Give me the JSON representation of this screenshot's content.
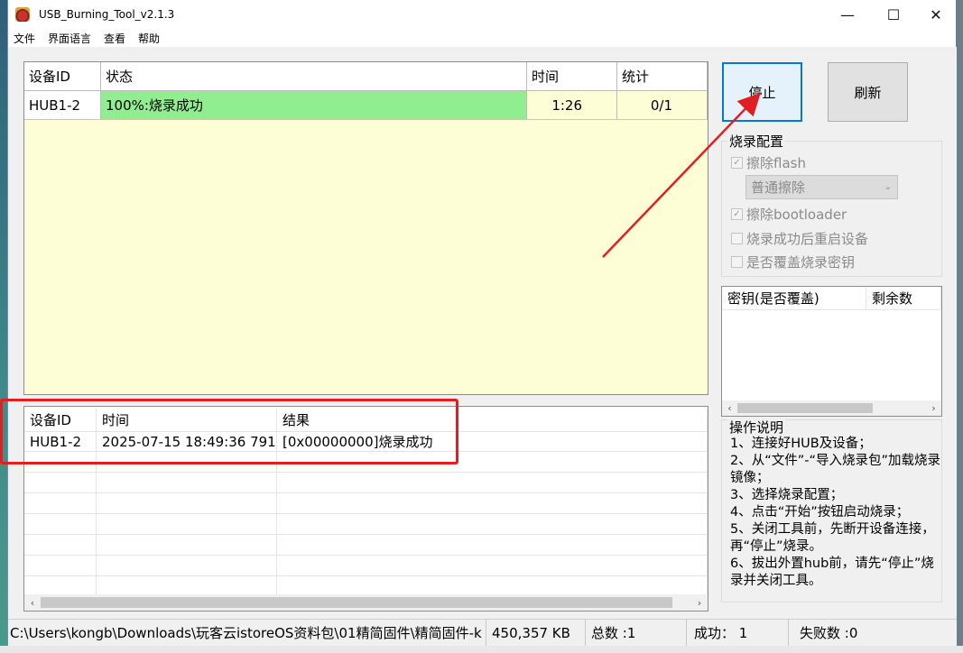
{
  "window": {
    "title": "USB_Burning_Tool_v2.1.3",
    "minimize": "—",
    "maximize": "☐",
    "close": "✕"
  },
  "menu": [
    "文件",
    "界面语言",
    "查看",
    "帮助"
  ],
  "device_table": {
    "headers": [
      "设备ID",
      "状态",
      "时间",
      "统计"
    ],
    "rows": [
      {
        "id": "HUB1-2",
        "status": "100%:烧录成功",
        "time": "1:26",
        "stats": "0/1"
      }
    ]
  },
  "log_table": {
    "headers": [
      "设备ID",
      "时间",
      "结果"
    ],
    "rows": [
      {
        "id": "HUB1-2",
        "time": "2025-07-15 18:49:36 791",
        "result": "[0x00000000]烧录成功"
      }
    ]
  },
  "buttons": {
    "stop": "停止",
    "refresh": "刷新"
  },
  "burn_config": {
    "title": "烧录配置",
    "erase_flash": "擦除flash",
    "erase_mode": "普通擦除",
    "erase_bootloader": "擦除bootloader",
    "reboot_after": "烧录成功后重启设备",
    "overwrite_key": "是否覆盖烧录密钥"
  },
  "key_table": {
    "headers": [
      "密钥(是否覆盖)",
      "剩余数"
    ]
  },
  "instructions": {
    "title": "操作说明",
    "text": "1、连接好HUB及设备；\n2、从“文件”-“导入烧录包”加载烧录镜像；\n3、选择烧录配置；\n4、点击“开始”按钮启动烧录；\n5、关闭工具前，先断开设备连接，再“停止”烧录。\n6、拔出外置hub前，请先“停止”烧录并关闭工具。"
  },
  "statusbar": {
    "path": "C:\\Users\\kongb\\Downloads\\玩客云istoreOS资料包\\01精简固件\\精简固件-k",
    "size": "450,357 KB",
    "total": "总数 :1",
    "success": "成功： 1",
    "failed": "失败数 :0"
  },
  "colors": {
    "status_success": "#90ee90",
    "table_bg": "#fdfdd6",
    "annotation": "#e02020",
    "accent": "#0078d7"
  }
}
